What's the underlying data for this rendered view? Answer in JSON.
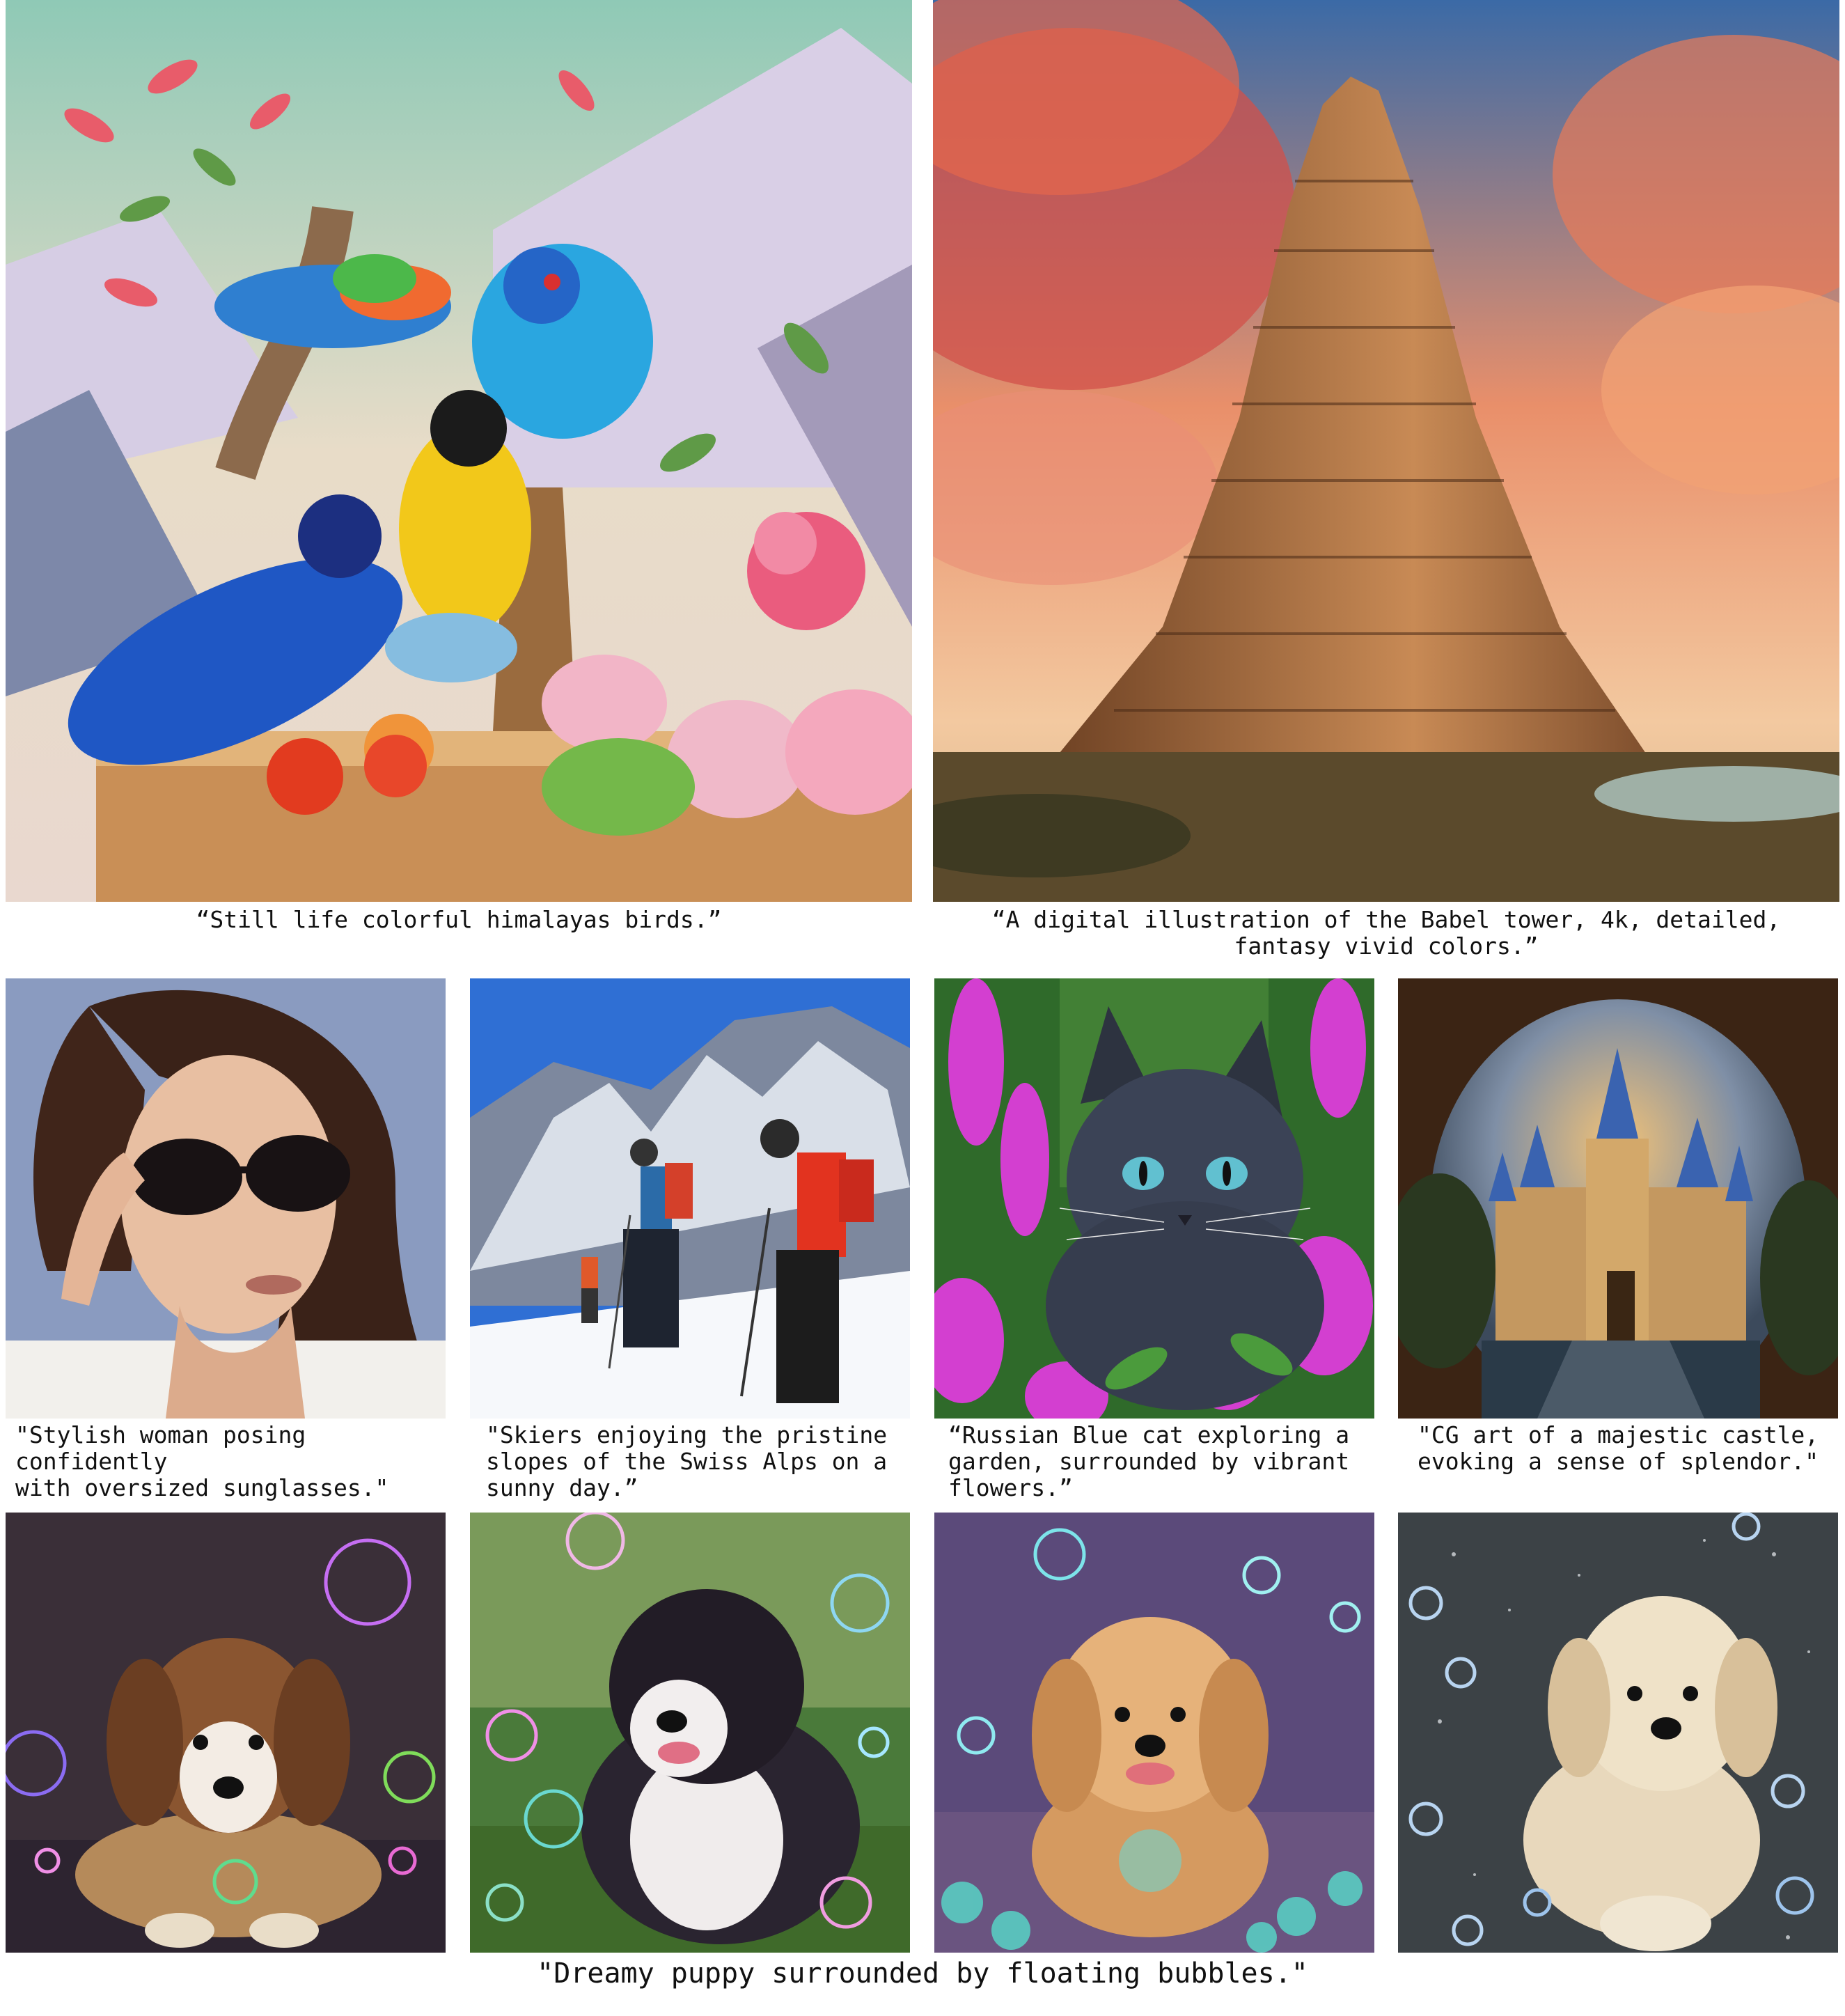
{
  "top_row": [
    {
      "caption": "“Still life colorful himalayas birds.”"
    },
    {
      "caption": "“A digital illustration of the Babel tower, 4k, detailed,\nfantasy vivid colors.”"
    }
  ],
  "middle_row": [
    {
      "caption": "\"Stylish woman posing confidently\nwith oversized sunglasses.\""
    },
    {
      "caption": "\"Skiers enjoying the pristine\nslopes of the Swiss Alps on a\nsunny day.”"
    },
    {
      "caption": "“Russian Blue cat exploring a\ngarden, surrounded by vibrant\nflowers.”"
    },
    {
      "caption": "\"CG art of a majestic castle,\nevoking a sense of splendor.\""
    }
  ],
  "bottom_row": {
    "caption": "\"Dreamy puppy surrounded by floating bubbles.\""
  }
}
